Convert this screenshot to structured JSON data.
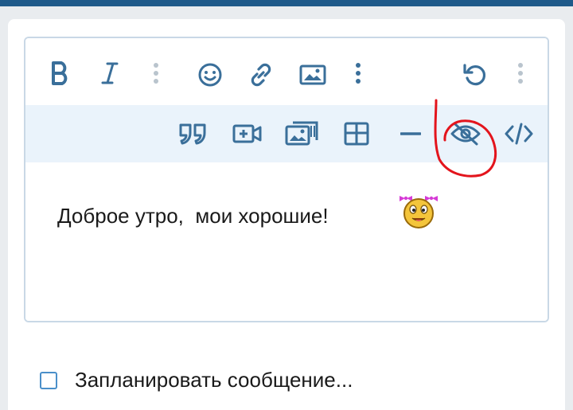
{
  "editor": {
    "toolbar_row1": [
      {
        "name": "bold-button",
        "icon": "bold-icon"
      },
      {
        "name": "italic-button",
        "icon": "italic-icon"
      },
      {
        "name": "more-text-options-button",
        "icon": "vertical-dots-icon"
      },
      {
        "name": "emoji-button",
        "icon": "smiley-icon"
      },
      {
        "name": "insert-link-button",
        "icon": "link-icon"
      },
      {
        "name": "insert-image-button",
        "icon": "image-icon"
      },
      {
        "name": "more-insert-options-button",
        "icon": "vertical-dots-icon"
      },
      {
        "name": "undo-button",
        "icon": "undo-icon"
      },
      {
        "name": "more-options-button",
        "icon": "vertical-dots-icon"
      }
    ],
    "toolbar_row2": [
      {
        "name": "quote-button",
        "icon": "quote-icon"
      },
      {
        "name": "insert-video-button",
        "icon": "video-plus-icon"
      },
      {
        "name": "insert-gallery-button",
        "icon": "gallery-icon"
      },
      {
        "name": "insert-table-button",
        "icon": "table-icon"
      },
      {
        "name": "horizontal-line-button",
        "icon": "minus-icon"
      },
      {
        "name": "spoiler-button",
        "icon": "eye-slash-icon"
      },
      {
        "name": "code-button",
        "icon": "code-icon"
      }
    ],
    "message_text": "Доброе утро,  мои хорошие!",
    "smiley": "smiley-with-bows-icon",
    "annotation": "red-hand-drawn-circle"
  },
  "schedule": {
    "checked": false,
    "label": "Запланировать сообщение..."
  },
  "colors": {
    "header": "#1f5a8a",
    "icon": "#3a6f9a",
    "toolbar_row2_bg": "#eaf3fb",
    "editor_border": "#c9d8e6",
    "checkbox": "#4a8fc9",
    "annotation": "#e3141c"
  }
}
